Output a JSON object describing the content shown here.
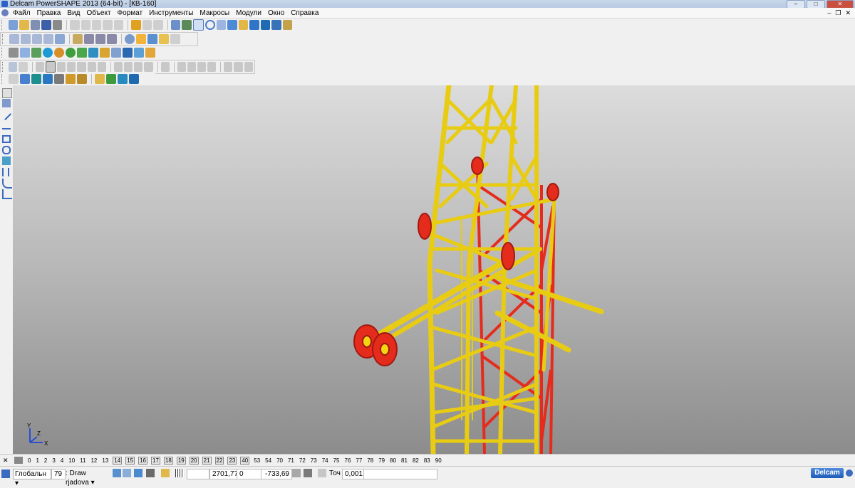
{
  "window": {
    "title": "Delcam PowerSHAPE 2013 (64-bit) - [КВ-160]"
  },
  "menu": [
    "Файл",
    "Правка",
    "Вид",
    "Объект",
    "Формат",
    "Инструменты",
    "Макросы",
    "Модули",
    "Окно",
    "Справка"
  ],
  "levels": [
    "0",
    "1",
    "2",
    "3",
    "4",
    "10",
    "11",
    "12",
    "13",
    "14",
    "15",
    "16",
    "17",
    "18",
    "19",
    "20",
    "21",
    "22",
    "23",
    "40",
    "53",
    "54",
    "70",
    "71",
    "72",
    "73",
    "74",
    "75",
    "76",
    "77",
    "78",
    "79",
    "80",
    "81",
    "82",
    "83",
    "90"
  ],
  "levels_boxed_from": "14",
  "levels_boxed_to": "40",
  "status": {
    "workplane": "Глобальн",
    "level_number": "79",
    "level_name": ": Draw rjadova",
    "x": "2701,77",
    "y": "0",
    "z": "-733,69",
    "tolerance_label": "Точ",
    "tolerance": "0,001"
  },
  "brand": "Delcam",
  "axis": {
    "x": "X",
    "y": "Y",
    "z": "Z"
  },
  "colors": {
    "tower": "#f2d611",
    "tower_dark": "#b89a06",
    "inner": "#e52b1c",
    "viewport_top": "#dcdcdc",
    "viewport_bottom": "#8c8c8c"
  }
}
